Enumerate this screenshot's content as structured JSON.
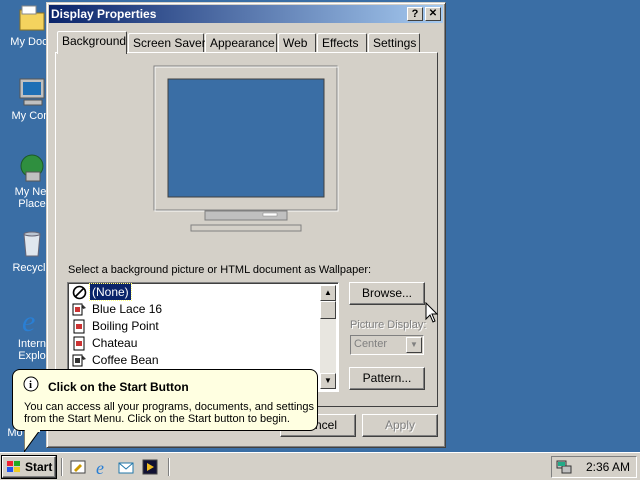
{
  "desktop": {
    "icons": [
      {
        "label": "My Docu"
      },
      {
        "label": "My Com"
      },
      {
        "label": "My Net Place"
      },
      {
        "label": "Recycle"
      },
      {
        "label": "Intern Explo"
      },
      {
        "label": "Mo"
      }
    ]
  },
  "window": {
    "title": "Display Properties",
    "help_btn": "?",
    "close_btn": "✕",
    "tabs": [
      {
        "label": "Background"
      },
      {
        "label": "Screen Saver"
      },
      {
        "label": "Appearance"
      },
      {
        "label": "Web"
      },
      {
        "label": "Effects"
      },
      {
        "label": "Settings"
      }
    ],
    "wallpaper_label": "Select a background picture or HTML document as Wallpaper:",
    "wallpapers": [
      {
        "label": "(None)",
        "icon": "none-icon",
        "selected": true
      },
      {
        "label": "Blue Lace 16",
        "icon": "paint-icon"
      },
      {
        "label": "Boiling Point",
        "icon": "html-doc-icon"
      },
      {
        "label": "Chateau",
        "icon": "html-doc-icon"
      },
      {
        "label": "Coffee Bean",
        "icon": "paint-icon"
      }
    ],
    "browse_label": "Browse...",
    "picture_display_label": "Picture Display:",
    "picture_display_value": "Center",
    "pattern_label": "Pattern...",
    "cancel_label": "ncel",
    "apply_label": "Apply"
  },
  "balloon": {
    "title": "Click on the Start Button",
    "body_line1": "You can access all your programs, documents, and settings",
    "body_line2": "from the Start Menu. Click on the Start button to begin."
  },
  "taskbar": {
    "start_label": "Start",
    "clock": "2:36 AM"
  },
  "colors": {
    "desktop": "#3a6ea5",
    "titlebar": "#0a246a",
    "selection": "#0a246a",
    "balloon": "#ffffe1"
  }
}
